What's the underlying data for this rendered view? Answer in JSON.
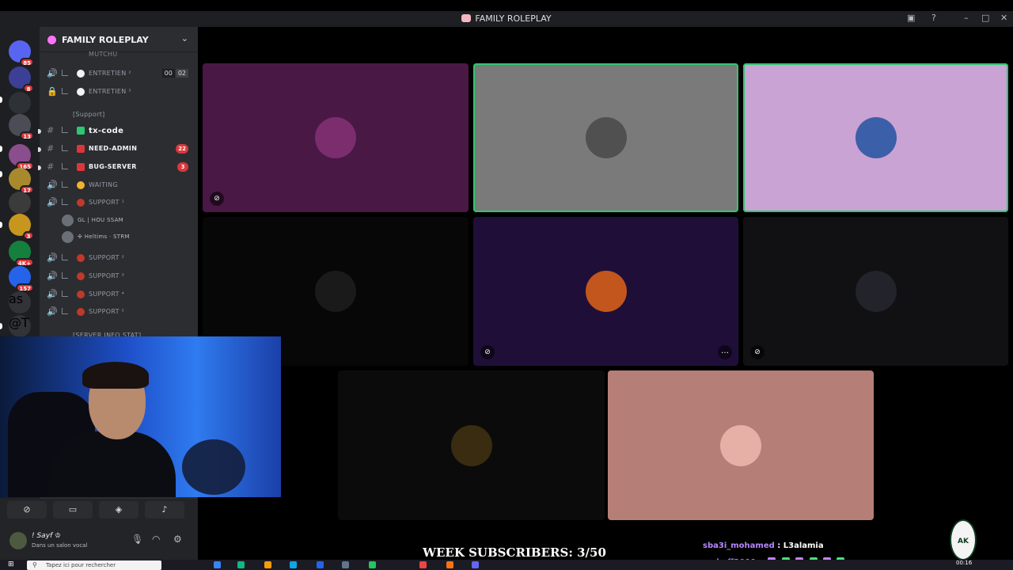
{
  "window": {
    "title": "FAMILY ROLEPLAY",
    "controls": [
      "inbox-icon",
      "help-icon",
      "minimize-icon",
      "maximize-icon",
      "close-icon"
    ]
  },
  "servers": [
    {
      "name": "direct-messages",
      "badge": "85",
      "color": "#5865f2",
      "glyph": ""
    },
    {
      "name": "server-1",
      "badge": "8",
      "color": "#3c3f96",
      "glyph": ""
    },
    {
      "name": "server-2",
      "badge": "",
      "color": "#2e3136",
      "glyph": ""
    },
    {
      "name": "server-3",
      "badge": "13",
      "color": "#4a4d55",
      "glyph": ""
    },
    {
      "name": "server-4",
      "badge": "165",
      "color": "#8a4d8d",
      "glyph": ""
    },
    {
      "name": "server-5",
      "badge": "17",
      "color": "#a88a2c",
      "glyph": ""
    },
    {
      "name": "server-6",
      "badge": "",
      "color": "#3b3b3b",
      "glyph": ""
    },
    {
      "name": "server-7",
      "badge": "3",
      "color": "#c7961e",
      "glyph": ""
    },
    {
      "name": "server-8",
      "badge": "4K+",
      "color": "#15803d",
      "glyph": ""
    },
    {
      "name": "server-9",
      "badge": "157",
      "color": "#2563eb",
      "glyph": ""
    },
    {
      "name": "server-as",
      "badge": "",
      "color": "#313338",
      "glyph": "as"
    },
    {
      "name": "server-at",
      "badge": "56",
      "color": "#313338",
      "glyph": "@T"
    }
  ],
  "guild": {
    "name": "FAMILY ROLEPLAY",
    "top_partial": "MUTCHU",
    "channels": [
      {
        "type": "voice",
        "label": "ENTRETIEN ²",
        "emoji_color": "#f2f3f5",
        "limit": [
          "00",
          "02"
        ]
      },
      {
        "type": "locked",
        "label": "ENTRETIEN ³",
        "emoji_color": "#f2f3f5"
      },
      {
        "type": "category",
        "label": "[Support]"
      },
      {
        "type": "text",
        "label": "tx-code",
        "emoji_color": "#2dc770",
        "bold": true,
        "unread": true
      },
      {
        "type": "text",
        "label": "NEED-ADMIN",
        "emoji_color": "#da373c",
        "bold": true,
        "count": "22",
        "unread": true
      },
      {
        "type": "text",
        "label": "BUG-SERVER",
        "emoji_color": "#da373c",
        "bold": true,
        "count": "3",
        "unread": true
      },
      {
        "type": "voice",
        "label": "WAITING",
        "emoji_color": "#f0b232"
      },
      {
        "type": "voice",
        "label": "SUPPORT ¹",
        "emoji_color": "#c0392b"
      },
      {
        "type": "user",
        "label": "GL | HOU SSAM"
      },
      {
        "type": "user",
        "label": "✣ Heltims · STRM"
      },
      {
        "type": "voice",
        "label": "SUPPORT ²",
        "emoji_color": "#c0392b"
      },
      {
        "type": "voice",
        "label": "SUPPORT ³",
        "emoji_color": "#c0392b"
      },
      {
        "type": "voice",
        "label": "SUPPORT ⁴",
        "emoji_color": "#c0392b"
      },
      {
        "type": "voice",
        "label": "SUPPORT ⁵",
        "emoji_color": "#c0392b"
      },
      {
        "type": "category",
        "label": "[SERVER INFO STAT]"
      }
    ]
  },
  "user_panel": {
    "name": "! Sayf ♔",
    "status": "Dans un salon vocal",
    "voice_buttons": [
      "video-off-icon",
      "screen-share-icon",
      "activity-icon",
      "soundboard-icon"
    ],
    "controls": [
      "microphone-icon",
      "headphones-icon",
      "settings-icon"
    ]
  },
  "tiles": [
    {
      "bg": "#4a1845",
      "avatar": "#7b2d6e",
      "muted": true,
      "speaking": false,
      "more": false
    },
    {
      "bg": "#7a7a7a",
      "avatar": "#505050",
      "muted": false,
      "speaking": true,
      "more": false
    },
    {
      "bg": "#c9a3d3",
      "avatar": "#3b5fa8",
      "muted": false,
      "speaking": true,
      "more": false
    },
    {
      "bg": "#070707",
      "avatar": "#1a1a1a",
      "muted": false,
      "speaking": false,
      "more": false
    },
    {
      "bg": "#1f0f38",
      "avatar": "#c2561c",
      "muted": true,
      "speaking": false,
      "more": true
    },
    {
      "bg": "#111114",
      "avatar": "#22232b",
      "muted": true,
      "speaking": false,
      "more": false
    },
    {
      "bg": "#0b0b0b",
      "avatar": "#3a2c10",
      "muted": false,
      "speaking": false,
      "more": false
    },
    {
      "bg": "#b57f77",
      "avatar": "#e7b0a6",
      "muted": false,
      "speaking": false,
      "more": false
    }
  ],
  "overlay": {
    "subscribers": "WEEK SUBSCRIBERS: 3/50",
    "chat": [
      {
        "user": "sba3i_mohamed",
        "message": "L3alamia"
      },
      {
        "user": "mohaff2000",
        "message": ""
      }
    ],
    "logo": "AK"
  },
  "taskbar": {
    "search_placeholder": "Tapez ici pour rechercher",
    "clock": "00:16"
  }
}
